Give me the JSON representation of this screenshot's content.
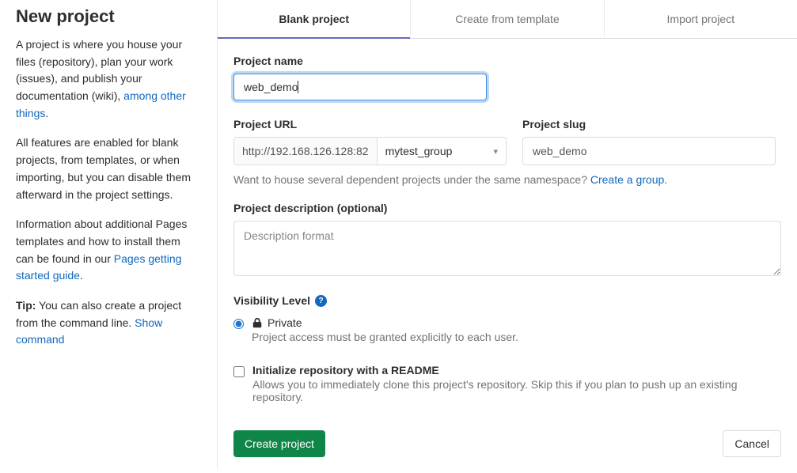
{
  "sidebar": {
    "title": "New project",
    "para1a": "A project is where you house your files (repository), plan your work (issues), and publish your documentation (wiki), ",
    "para1_link": "among other things",
    "para1b": ".",
    "para2": "All features are enabled for blank projects, from templates, or when importing, but you can disable them afterward in the project settings.",
    "para3a": "Information about additional Pages templates and how to install them can be found in our ",
    "para3_link": "Pages getting started guide",
    "para3b": ".",
    "tip_label": "Tip:",
    "tip_text": " You can also create a project from the command line. ",
    "tip_link": "Show command"
  },
  "tabs": {
    "blank": "Blank project",
    "template": "Create from template",
    "import": "Import project"
  },
  "form": {
    "name_label": "Project name",
    "name_value": "web_demo",
    "url_label": "Project URL",
    "url_prefix": "http://192.168.126.128:82",
    "url_group": "mytest_group",
    "slug_label": "Project slug",
    "slug_value": "web_demo",
    "namespace_hint": "Want to house several dependent projects under the same namespace? ",
    "namespace_link": "Create a group.",
    "desc_label": "Project description (optional)",
    "desc_placeholder": "Description format",
    "visibility_label": "Visibility Level",
    "vis_private_title": "Private",
    "vis_private_desc": "Project access must be granted explicitly to each user.",
    "readme_title": "Initialize repository with a README",
    "readme_desc": "Allows you to immediately clone this project's repository. Skip this if you plan to push up an existing repository.",
    "create_btn": "Create project",
    "cancel_btn": "Cancel"
  }
}
